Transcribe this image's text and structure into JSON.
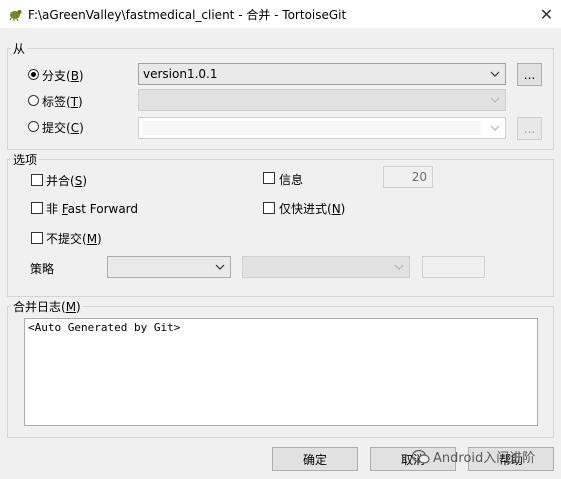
{
  "window": {
    "title": "F:\\aGreenValley\\fastmedical_client - 合并 - TortoiseGit",
    "close_glyph": "✕"
  },
  "from_group": {
    "label": "从",
    "branch": {
      "label": "分支(",
      "key": "B",
      "suffix": ")",
      "value": "version1.0.1",
      "browse": "..."
    },
    "tag": {
      "label": "标签(",
      "key": "T",
      "suffix": ")"
    },
    "commit": {
      "label": "提交(",
      "key": "C",
      "suffix": ")",
      "browse": "..."
    }
  },
  "options_group": {
    "label": "选项",
    "squash": {
      "label": "并合(",
      "key": "S",
      "suffix": ")"
    },
    "message": {
      "label": "信息",
      "value": "20"
    },
    "no_ff": {
      "label": "非 ",
      "key": "F",
      "rest": "ast Forward"
    },
    "ff_only": {
      "label": "仅快进式(",
      "key": "N",
      "suffix": ")"
    },
    "no_commit": {
      "label": "不提交(",
      "key": "M",
      "suffix": ")"
    },
    "strategy": {
      "label": "策略"
    }
  },
  "merge_log": {
    "label": "合并日志(",
    "key": "M",
    "suffix": ")",
    "text": "<Auto Generated by Git>"
  },
  "buttons": {
    "ok": "确定",
    "cancel": "取消",
    "help": "帮助"
  },
  "watermark": {
    "text": "Android入门进阶"
  }
}
